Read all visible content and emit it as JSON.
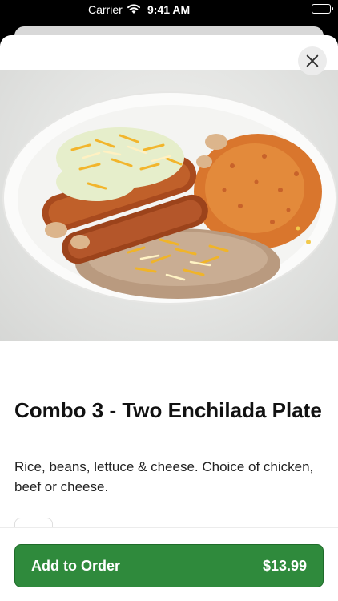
{
  "status_bar": {
    "carrier": "Carrier",
    "time": "9:41 AM"
  },
  "item": {
    "title": "Combo 3 - Two Enchilada Plate",
    "description": "Rice, beans, lettuce & cheese. Choice of chicken, beef or cheese.",
    "image_icon": "food-photo"
  },
  "actions": {
    "close_icon": "close-icon",
    "add_label": "Add to Order",
    "price": "$13.99"
  },
  "colors": {
    "accent": "#2f8a3c",
    "background": "#ffffff",
    "status_bar": "#000000"
  }
}
